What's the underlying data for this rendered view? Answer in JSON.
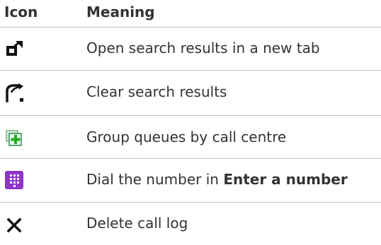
{
  "header": {
    "icon_col": "Icon",
    "meaning_col": "Meaning"
  },
  "rows": [
    {
      "icon": "open-in-new-tab-icon",
      "meaning": "Open search results in a new tab"
    },
    {
      "icon": "clear-search-icon",
      "meaning": "Clear search results"
    },
    {
      "icon": "group-queues-icon",
      "meaning": "Group queues by call centre",
      "icon_colors": {
        "frame": "#2e8b57",
        "plus": "#22aa22"
      }
    },
    {
      "icon": "dialpad-icon",
      "meaning_prefix": "Dial the number in ",
      "meaning_bold": "Enter a number",
      "icon_colors": {
        "background": "#8e35c6"
      }
    },
    {
      "icon": "close-icon",
      "meaning": "Delete call log"
    }
  ]
}
